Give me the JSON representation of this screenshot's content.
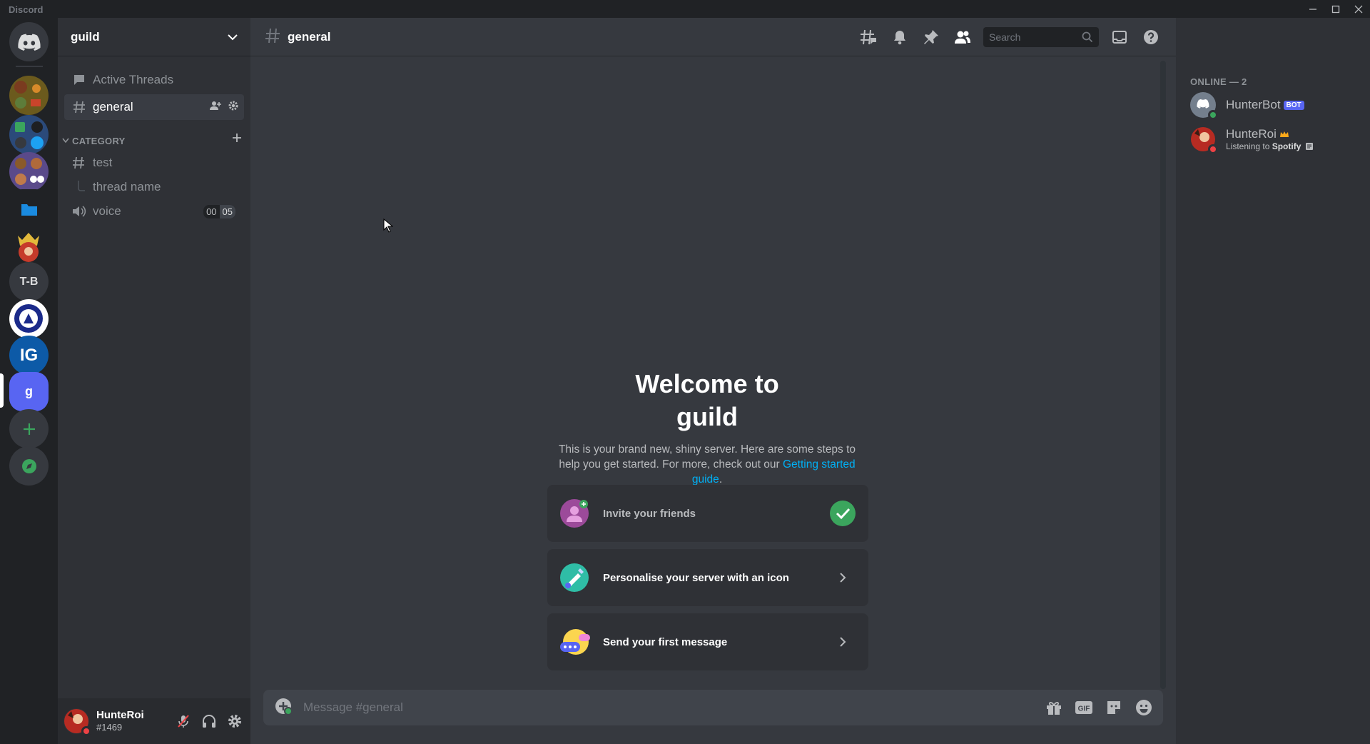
{
  "app": {
    "title": "Discord"
  },
  "colors": {
    "brand": "#5865f2",
    "online": "#3ba55d",
    "dnd": "#ed4245",
    "link": "#00b0f4",
    "green": "#3ba55d"
  },
  "rail": {
    "servers": [
      {
        "name": "server-1",
        "icon": "image-avatar-cluster"
      },
      {
        "name": "server-2",
        "icon": "image-avatar-cluster"
      },
      {
        "name": "server-3",
        "icon": "image-avatar-cluster"
      },
      {
        "name": "folder",
        "icon": "folder-icon"
      },
      {
        "name": "server-crown",
        "icon": "image-character"
      },
      {
        "name": "T-B",
        "label": "T-B"
      },
      {
        "name": "server-crest",
        "icon": "image-crest"
      },
      {
        "name": "IG",
        "label": "IG"
      },
      {
        "name": "guild",
        "label": "g"
      }
    ],
    "add_label": "+",
    "explore_label": "explore"
  },
  "sidebar": {
    "guild_name": "guild",
    "active_threads": "Active Threads",
    "channels": {
      "general": "general",
      "category": "CATEGORY",
      "test": "test",
      "thread": "thread name",
      "voice": "voice",
      "voice_count_a": "00",
      "voice_count_b": "05"
    }
  },
  "user": {
    "name": "HunteRoi",
    "tag": "#1469"
  },
  "header": {
    "channel": "general",
    "search_placeholder": "Search"
  },
  "welcome": {
    "title_line1": "Welcome to",
    "title_line2": "guild",
    "desc": "This is your brand new, shiny server. Here are some steps to help you get started. For more, check out our ",
    "link": "Getting started guide",
    "desc_end": ".",
    "cards": [
      {
        "label": "Invite your friends",
        "done": true
      },
      {
        "label": "Personalise your server with an icon",
        "done": false
      },
      {
        "label": "Send your first message",
        "done": false
      }
    ]
  },
  "composer": {
    "placeholder": "Message #general"
  },
  "members": {
    "heading": "ONLINE — 2",
    "list": [
      {
        "name": "HunterBot",
        "tag": "BOT"
      },
      {
        "name": "HunteRoi",
        "activity_prefix": "Listening to ",
        "activity_app": "Spotify"
      }
    ]
  }
}
